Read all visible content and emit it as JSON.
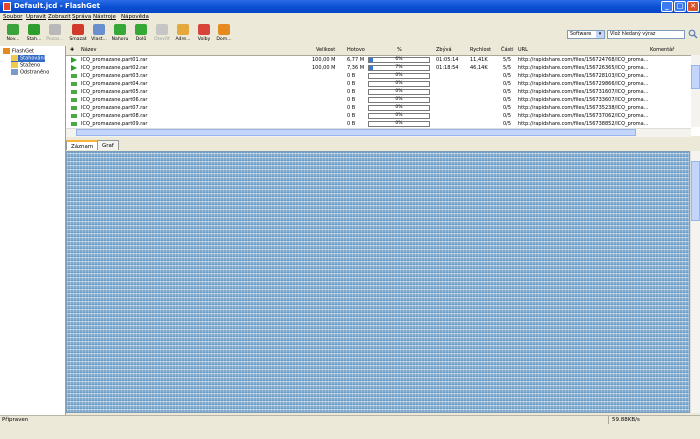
{
  "window": {
    "title": "Default.jcd - FlashGet",
    "minimize": "_",
    "maximize": "□",
    "close": "✕"
  },
  "menu": [
    "Soubor",
    "Upravit",
    "Zobrazit",
    "Správa",
    "Nástroje",
    "Nápověda"
  ],
  "toolbar": [
    {
      "label": "Nov...",
      "icon": "new-download-icon",
      "color": "#3aa33a",
      "disabled": false
    },
    {
      "label": "Stah...",
      "icon": "start-icon",
      "color": "#2e9f2e",
      "disabled": false
    },
    {
      "label": "Pozas...",
      "icon": "pause-icon",
      "color": "#b8b8b8",
      "disabled": true
    },
    {
      "label": "Smazat",
      "icon": "delete-icon",
      "color": "#d23a2a",
      "disabled": false
    },
    {
      "label": "Vlast...",
      "icon": "properties-icon",
      "color": "#6a8fd0",
      "disabled": false
    },
    {
      "label": "Nahoru",
      "icon": "up-arrow-icon",
      "color": "#35a835",
      "disabled": false
    },
    {
      "label": "Dolů",
      "icon": "down-arrow-icon",
      "color": "#35a835",
      "disabled": false
    },
    {
      "label": "Otevřít",
      "icon": "open-folder-icon",
      "color": "#c6c6c6",
      "disabled": true
    },
    {
      "label": "Adre...",
      "icon": "folder-icon",
      "color": "#e6a83a",
      "disabled": false
    },
    {
      "label": "Volby",
      "icon": "options-icon",
      "color": "#d8443a",
      "disabled": false
    },
    {
      "label": "Dom...",
      "icon": "home-icon",
      "color": "#e58a1f",
      "disabled": false
    }
  ],
  "search": {
    "category": "Software",
    "placeholder": "Vlož hledaný výraz"
  },
  "tree": [
    {
      "label": "FlashGet",
      "level": 0,
      "icon": "flashget-icon",
      "color": "#e58a1f"
    },
    {
      "label": "Stahování",
      "level": 1,
      "icon": "downloading-folder-icon",
      "color": "#f2c94c",
      "selected": true
    },
    {
      "label": "Staženo",
      "level": 1,
      "icon": "downloaded-folder-icon",
      "color": "#f2c94c"
    },
    {
      "label": "Odstraněno",
      "level": 1,
      "icon": "deleted-folder-icon",
      "color": "#7a9acb"
    }
  ],
  "columns": [
    "Název",
    "Velikost",
    "Hotovo",
    "%",
    "Zbývá",
    "Rychlost",
    "Části",
    "URL",
    "Komentář"
  ],
  "rows": [
    {
      "name": "ICQ_promazane.part01.rar",
      "size": "100,00 M",
      "done": "6,77 M",
      "percent": 6,
      "percent_label": "6%",
      "remaining": "01:05:14",
      "speed": "11,41K",
      "parts": "5/5",
      "url": "http://rapidshare.com/files/156724768/ICQ_proma...",
      "status": "active"
    },
    {
      "name": "ICQ_promazane.part02.rar",
      "size": "100,00 M",
      "done": "7,36 M",
      "percent": 7,
      "percent_label": "7%",
      "remaining": "01:18:54",
      "speed": "46,14K",
      "parts": "5/5",
      "url": "http://rapidshare.com/files/156726365/ICQ_proma...",
      "status": "active"
    },
    {
      "name": "ICQ_promazane.part03.rar",
      "size": "",
      "done": "0 B",
      "percent": 0,
      "percent_label": "0%",
      "remaining": "",
      "speed": "",
      "parts": "0/5",
      "url": "http://rapidshare.com/files/156728103/ICQ_proma...",
      "status": "waiting"
    },
    {
      "name": "ICQ_promazane.part04.rar",
      "size": "",
      "done": "0 B",
      "percent": 0,
      "percent_label": "0%",
      "remaining": "",
      "speed": "",
      "parts": "0/5",
      "url": "http://rapidshare.com/files/156729866/ICQ_proma...",
      "status": "waiting"
    },
    {
      "name": "ICQ_promazane.part05.rar",
      "size": "",
      "done": "0 B",
      "percent": 0,
      "percent_label": "0%",
      "remaining": "",
      "speed": "",
      "parts": "0/5",
      "url": "http://rapidshare.com/files/156731607/ICQ_proma...",
      "status": "waiting"
    },
    {
      "name": "ICQ_promazane.part06.rar",
      "size": "",
      "done": "0 B",
      "percent": 0,
      "percent_label": "0%",
      "remaining": "",
      "speed": "",
      "parts": "0/5",
      "url": "http://rapidshare.com/files/156733607/ICQ_proma...",
      "status": "waiting"
    },
    {
      "name": "ICQ_promazane.part07.rar",
      "size": "",
      "done": "0 B",
      "percent": 0,
      "percent_label": "0%",
      "remaining": "",
      "speed": "",
      "parts": "0/5",
      "url": "http://rapidshare.com/files/156735238/ICQ_proma...",
      "status": "waiting"
    },
    {
      "name": "ICQ_promazane.part08.rar",
      "size": "",
      "done": "0 B",
      "percent": 0,
      "percent_label": "0%",
      "remaining": "",
      "speed": "",
      "parts": "0/5",
      "url": "http://rapidshare.com/files/156737062/ICQ_proma...",
      "status": "waiting"
    },
    {
      "name": "ICQ_promazane.part09.rar",
      "size": "",
      "done": "0 B",
      "percent": 0,
      "percent_label": "0%",
      "remaining": "",
      "speed": "",
      "parts": "0/5",
      "url": "http://rapidshare.com/files/156738852/ICQ_proma...",
      "status": "waiting"
    }
  ],
  "tabs": [
    {
      "label": "Záznam",
      "active": true
    },
    {
      "label": "Graf",
      "active": false
    }
  ],
  "statusbar": {
    "text": "Připraven",
    "speed": "59.88KB/s"
  },
  "colors": {
    "titlebar": "#0a4fd2",
    "progress": "#3a78d8",
    "log_pattern": "#7fa9cc"
  }
}
